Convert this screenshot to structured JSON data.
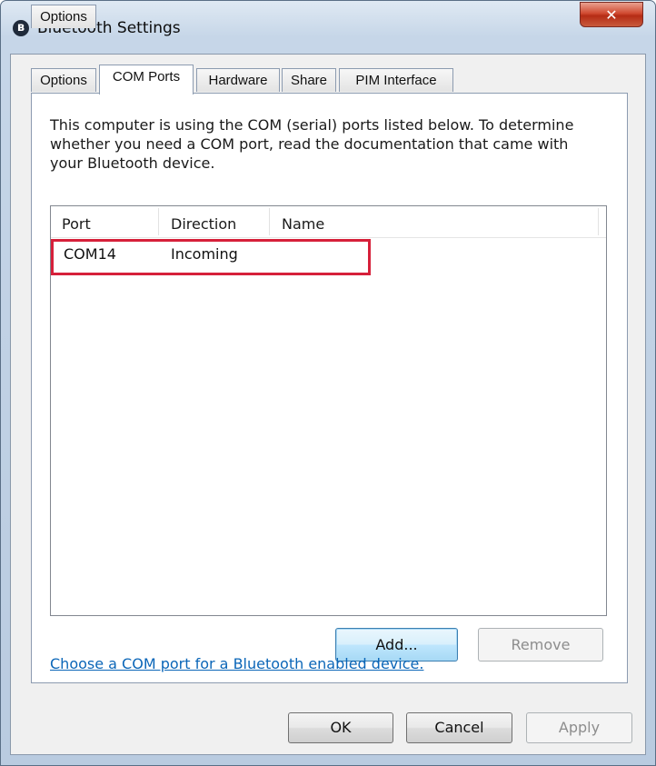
{
  "window": {
    "title": "Bluetooth Settings",
    "icon": "bluetooth-icon",
    "close_glyph": "✕"
  },
  "tabs": [
    {
      "label": "Options"
    },
    {
      "label": "COM Ports",
      "active": true
    },
    {
      "label": "Hardware"
    },
    {
      "label": "Share"
    },
    {
      "label": "PIM Interface"
    }
  ],
  "panel": {
    "description": "This computer is using the COM (serial) ports listed below. To determine whether you need a COM port, read the documentation that came with your Bluetooth device.",
    "list": {
      "columns": [
        "Port",
        "Direction",
        "Name"
      ],
      "rows": [
        {
          "port": "COM14",
          "direction": "Incoming",
          "name": ""
        }
      ]
    },
    "add_label": "Add...",
    "remove_label": "Remove",
    "link_text": "Choose a COM port for a Bluetooth enabled device."
  },
  "footer": {
    "ok_label": "OK",
    "cancel_label": "Cancel",
    "apply_label": "Apply"
  },
  "colors": {
    "highlight_border": "#d6203a",
    "link": "#0b66b8"
  }
}
